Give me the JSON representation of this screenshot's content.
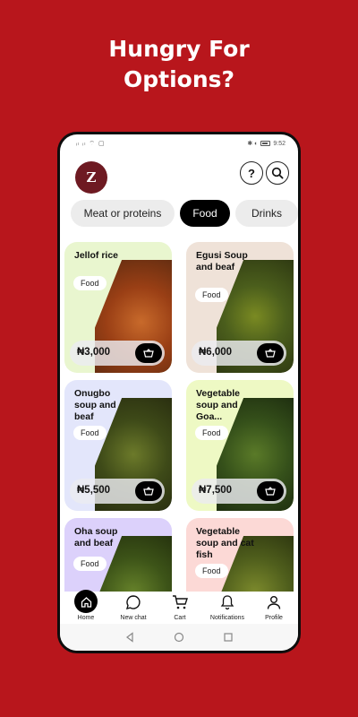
{
  "headline": {
    "line1": "Hungry For",
    "line2": "Options?"
  },
  "status_bar": {
    "left": "ᵢₗ ᵢₗ ⌔ ▢",
    "right_icons": "✱ ◐",
    "battery": "",
    "time": "9:52"
  },
  "header": {
    "logo_text": "Z",
    "help_glyph": "?",
    "search_glyph": "⌕"
  },
  "tabs": [
    {
      "label": "Meat or proteins",
      "active": false
    },
    {
      "label": "Food",
      "active": true
    },
    {
      "label": "Drinks",
      "active": false
    }
  ],
  "cards": [
    {
      "title": "Jellof rice",
      "tag": "Food",
      "price": "₦3,000",
      "bg": "#e9f6cf"
    },
    {
      "title": "Egusi Soup and beaf",
      "tag": "Food",
      "price": "₦6,000",
      "bg": "#efe2d8"
    },
    {
      "title": "Onugbo soup and beaf",
      "tag": "Food",
      "price": "₦5,500",
      "bg": "#e3e6fb"
    },
    {
      "title": "Vegetable soup and Goa...",
      "tag": "Food",
      "price": "₦7,500",
      "bg": "#eef9c4"
    },
    {
      "title": "Oha soup and beaf",
      "tag": "Food",
      "price": "",
      "bg": "#dcd1fb"
    },
    {
      "title": "Vegetable soup and cat fish",
      "tag": "Food",
      "price": "",
      "bg": "#fcd9d6"
    }
  ],
  "bottom_nav": [
    {
      "label": "Home",
      "icon": "home-icon"
    },
    {
      "label": "New chat",
      "icon": "chat-icon"
    },
    {
      "label": "Cart",
      "icon": "cart-icon"
    },
    {
      "label": "Notifications",
      "icon": "bell-icon"
    },
    {
      "label": "Profile",
      "icon": "person-icon"
    }
  ],
  "colors": {
    "brand_red": "#b8161c",
    "logo_maroon": "#6e1a22",
    "active_tab": "#000000"
  }
}
